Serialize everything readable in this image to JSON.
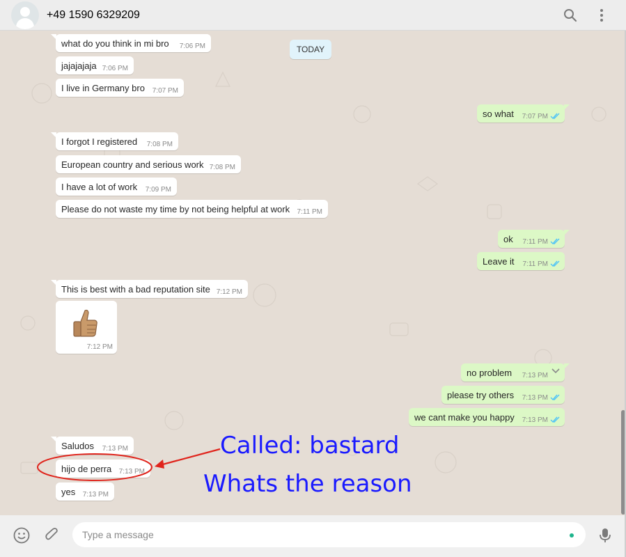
{
  "header": {
    "contact_name": "+49 1590 6329209",
    "icons": [
      "avatar",
      "search-icon",
      "menu-icon"
    ]
  },
  "date_chip": "TODAY",
  "messages": [
    {
      "dir": "in",
      "text": "what do you think in mi bro",
      "time": "7:06 PM"
    },
    {
      "dir": "in",
      "text": "jajajajaja",
      "time": "7:06 PM"
    },
    {
      "dir": "in",
      "text": "I live in Germany bro",
      "time": "7:07 PM"
    },
    {
      "dir": "out",
      "text": "so what",
      "time": "7:07 PM"
    },
    {
      "dir": "in",
      "text": "I forgot I registered",
      "time": "7:08 PM"
    },
    {
      "dir": "in",
      "text": "European country and serious work",
      "time": "7:08 PM"
    },
    {
      "dir": "in",
      "text": "I have a lot of work",
      "time": "7:09 PM"
    },
    {
      "dir": "in",
      "text": "Please do not waste my time by not being helpful at work",
      "time": "7:11 PM"
    },
    {
      "dir": "out",
      "text": "ok",
      "time": "7:11 PM"
    },
    {
      "dir": "out",
      "text": "Leave it",
      "time": "7:11 PM"
    },
    {
      "dir": "in",
      "text": "This is best with a bad reputation site",
      "time": "7:12 PM"
    },
    {
      "dir": "in",
      "text": "",
      "time": "7:12 PM",
      "sticker": "thumbs-up-icon"
    },
    {
      "dir": "out",
      "text": "no problem",
      "time": "7:13 PM"
    },
    {
      "dir": "out",
      "text": "please try others",
      "time": "7:13 PM"
    },
    {
      "dir": "out",
      "text": "we cant make you happy",
      "time": "7:13 PM"
    },
    {
      "dir": "in",
      "text": "Saludos",
      "time": "7:13 PM"
    },
    {
      "dir": "in",
      "text": "hijo de perra",
      "time": "7:13 PM"
    },
    {
      "dir": "in",
      "text": "yes",
      "time": "7:13 PM"
    }
  ],
  "annotation": {
    "line1": "Called: bastard",
    "line2": "Whats the reason",
    "color": "#1a1aff",
    "marker_color": "#e0241c"
  },
  "footer": {
    "placeholder": "Type a message",
    "icons": [
      "emoji-icon",
      "attach-icon",
      "mic-icon"
    ]
  },
  "colors": {
    "chat_bg": "#e5ddd5",
    "incoming": "#ffffff",
    "outgoing": "#dcf8c6",
    "read_ticks": "#4fc3f7"
  }
}
